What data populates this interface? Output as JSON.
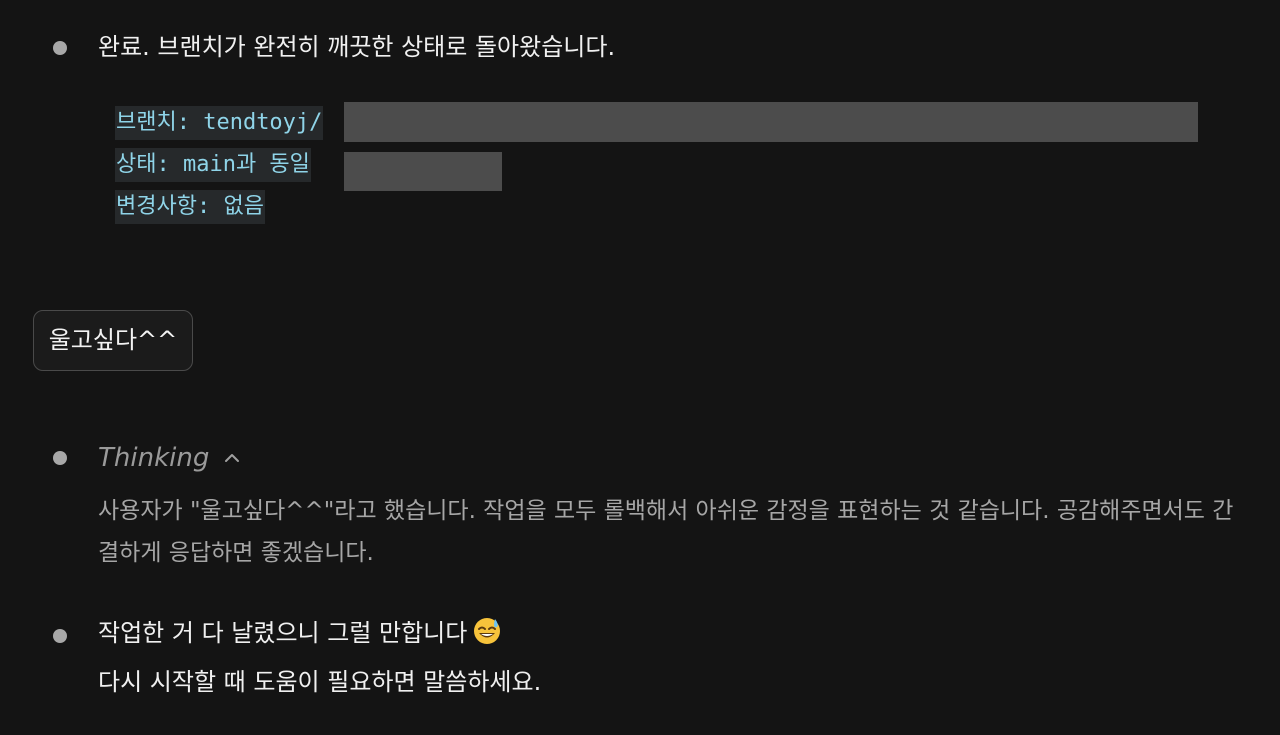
{
  "messages": {
    "first": {
      "text": "완료. 브랜치가 완전히 깨끗한 상태로 돌아왔습니다.",
      "code_lines": [
        "브랜치: tendtoyj/",
        "상태: main과 동일",
        "변경사항: 없음"
      ]
    },
    "user": {
      "text": "울고싶다^^"
    },
    "thinking": {
      "label": "Thinking",
      "caret_icon": "chevron-up-icon",
      "body": "사용자가 \"울고싶다^^\"라고 했습니다. 작업을 모두 롤백해서 아쉬운 감정을 표현하는 것 같습니다. 공감해주면서도 간결하게 응답하면 좋겠습니다."
    },
    "reply": {
      "line1": "작업한 거 다 날렸으니 그럴 만합니다",
      "emoji_icon": "grinning-sweat-emoji-icon",
      "line2": "다시 시작할 때 도움이 필요하면 말씀하세요."
    }
  },
  "colors": {
    "background": "#141414",
    "code_text": "#8fd4e8",
    "bullet": "#a8a8a8",
    "thinking": "#9a9a9a",
    "redaction": "#4c4c4c"
  }
}
